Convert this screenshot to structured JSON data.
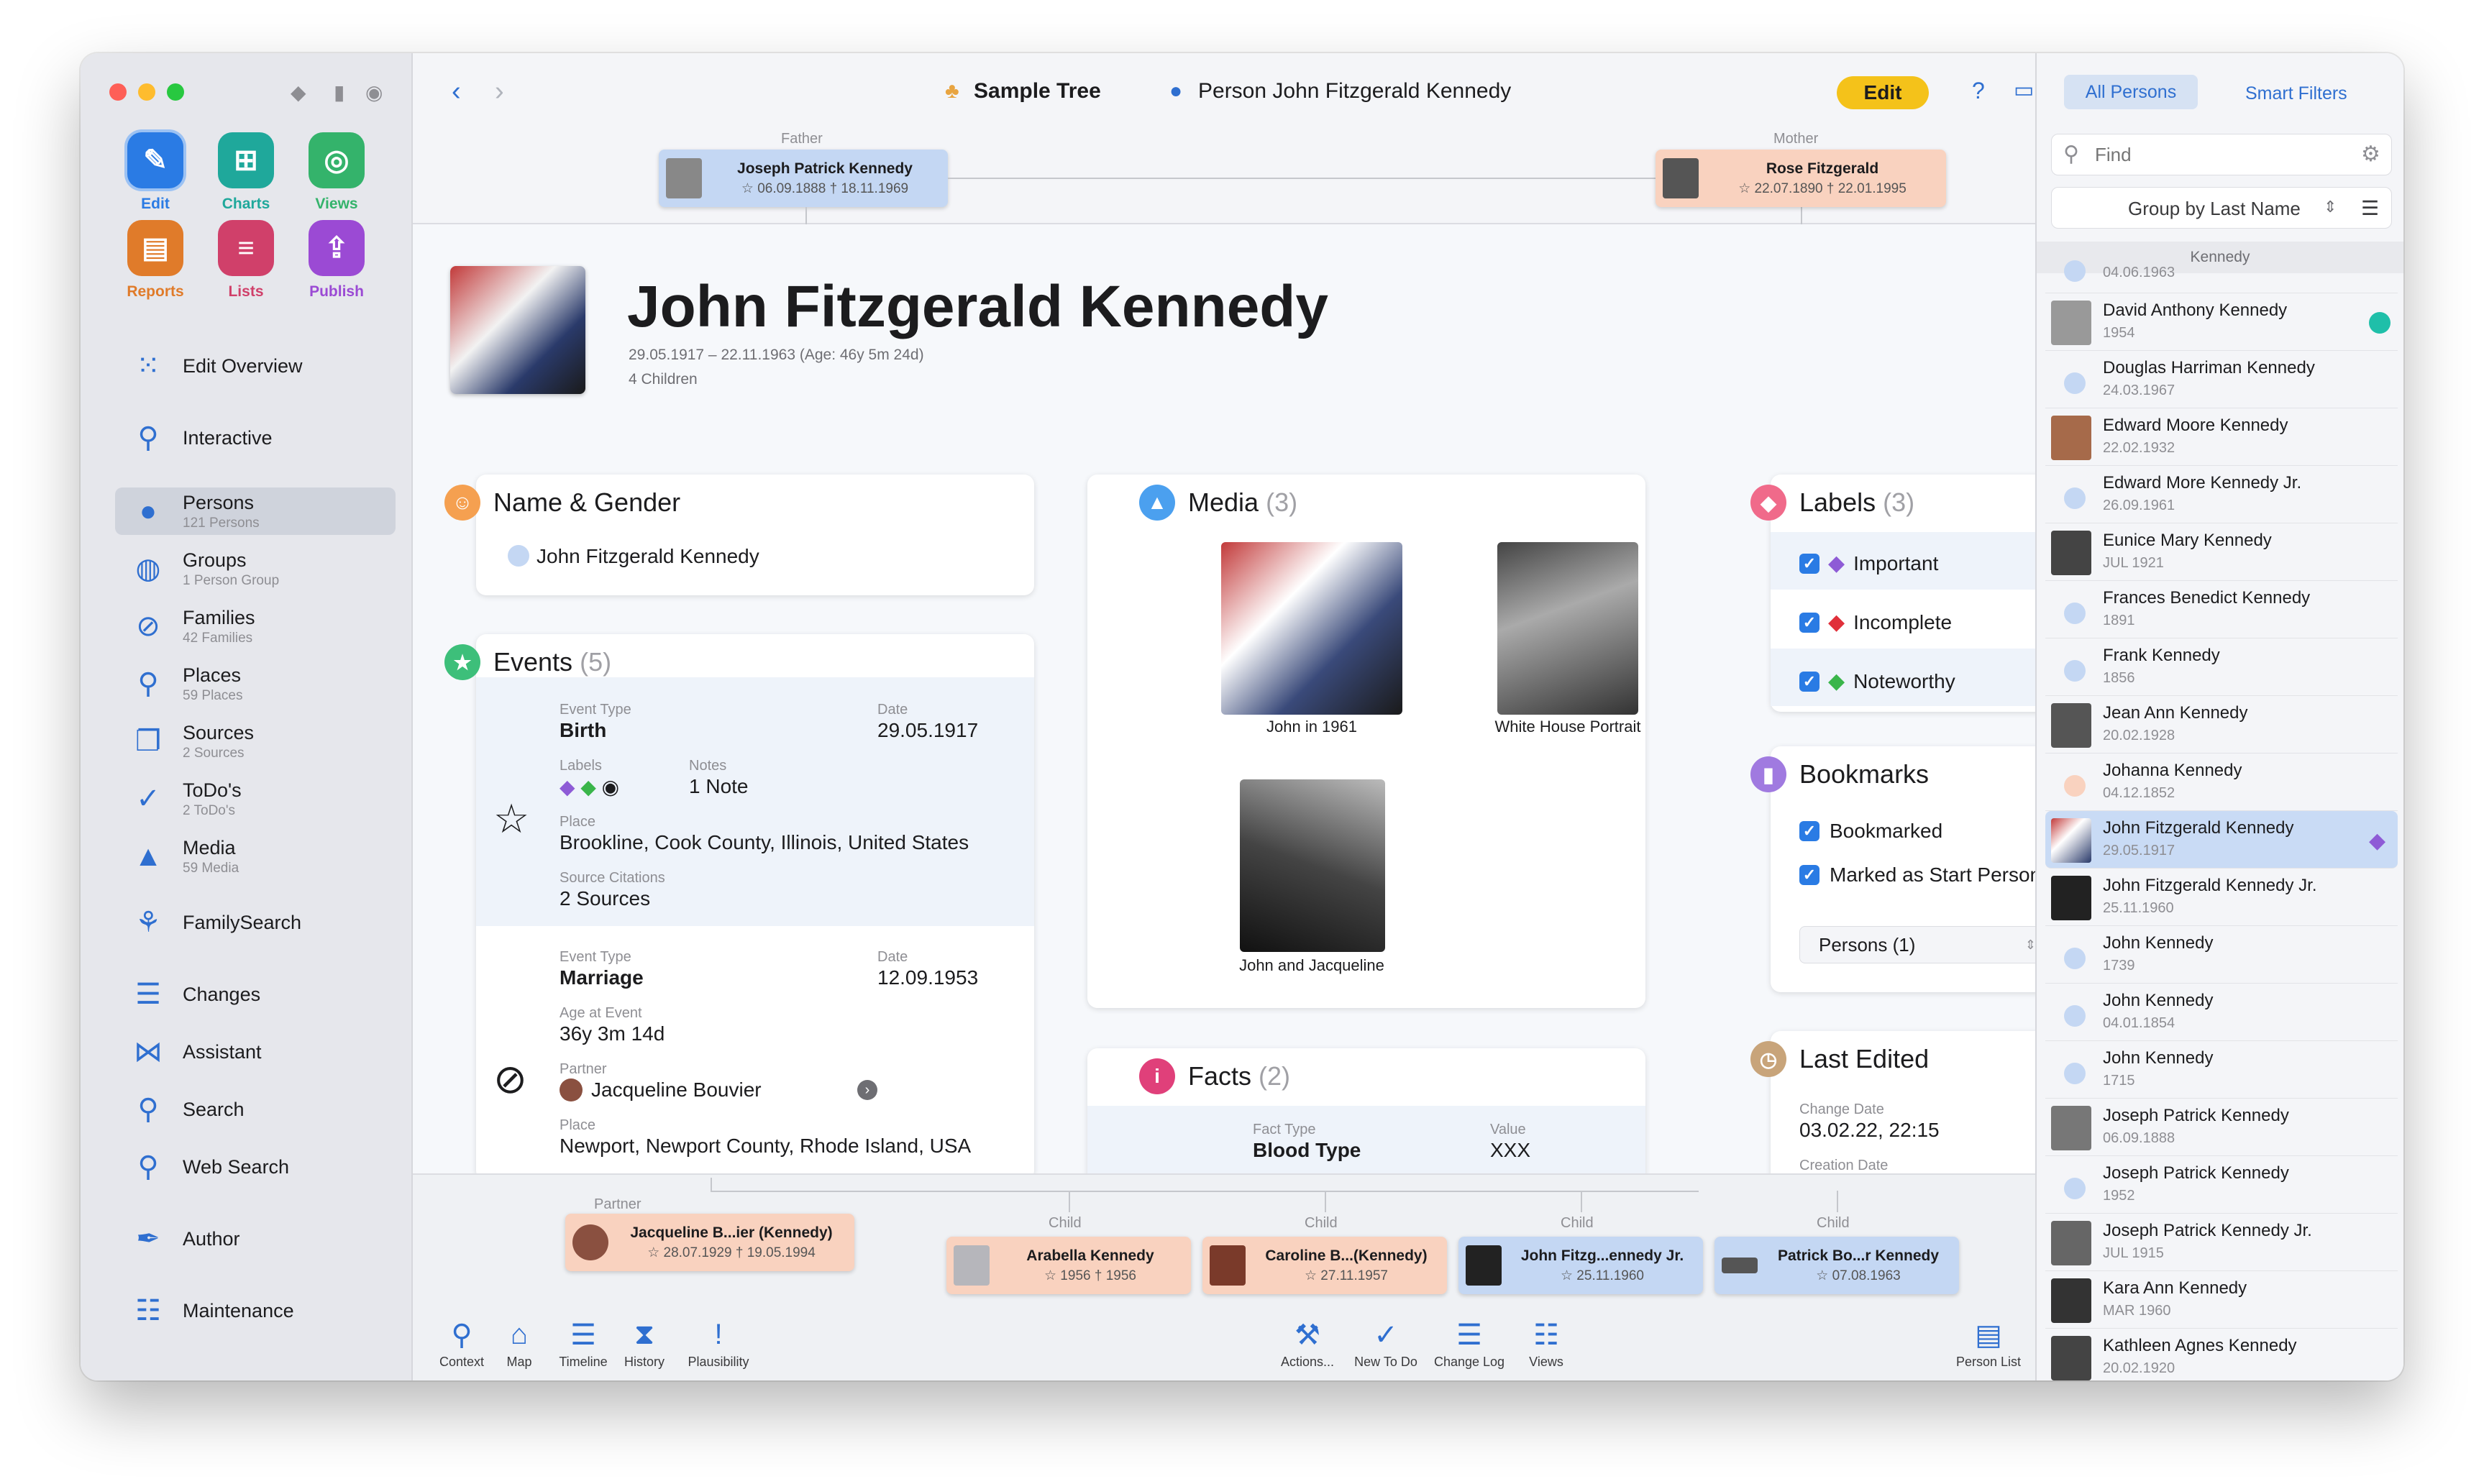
{
  "window": {
    "tree_name": "Sample Tree",
    "breadcrumb": "Person John Fitzgerald Kennedy",
    "edit_label": "Edit"
  },
  "quick_actions": [
    {
      "label": "Edit",
      "icon": "pencil-icon",
      "color": "#2a7be4"
    },
    {
      "label": "Charts",
      "icon": "charts-icon",
      "color": "#1fa89b"
    },
    {
      "label": "Views",
      "icon": "eye-icon",
      "color": "#34b36b"
    },
    {
      "label": "Reports",
      "icon": "reports-icon",
      "color": "#e07b2a"
    },
    {
      "label": "Lists",
      "icon": "lists-icon",
      "color": "#d0406a"
    },
    {
      "label": "Publish",
      "icon": "publish-icon",
      "color": "#9b4ad4"
    }
  ],
  "sidebar": {
    "items": [
      {
        "label": "Edit Overview",
        "sub": ""
      },
      {
        "label": "Interactive",
        "sub": ""
      },
      {
        "label": "Persons",
        "sub": "121 Persons"
      },
      {
        "label": "Groups",
        "sub": "1 Person Group"
      },
      {
        "label": "Families",
        "sub": "42 Families"
      },
      {
        "label": "Places",
        "sub": "59 Places"
      },
      {
        "label": "Sources",
        "sub": "2 Sources"
      },
      {
        "label": "ToDo's",
        "sub": "2 ToDo's"
      },
      {
        "label": "Media",
        "sub": "59 Media"
      },
      {
        "label": "FamilySearch",
        "sub": ""
      },
      {
        "label": "Changes",
        "sub": ""
      },
      {
        "label": "Assistant",
        "sub": ""
      },
      {
        "label": "Search",
        "sub": ""
      },
      {
        "label": "Web Search",
        "sub": ""
      },
      {
        "label": "Author",
        "sub": ""
      },
      {
        "label": "Maintenance",
        "sub": ""
      }
    ]
  },
  "parents": {
    "father_label": "Father",
    "father_name": "Joseph Patrick Kennedy",
    "father_dates": "☆ 06.09.1888 † 18.11.1969",
    "mother_label": "Mother",
    "mother_name": "Rose Fitzgerald",
    "mother_dates": "☆ 22.07.1890 † 22.01.1995"
  },
  "person": {
    "name": "John Fitzgerald Kennedy",
    "life": "29.05.1917 – 22.11.1963 (Age: 46y 5m 24d)",
    "children": "4 Children"
  },
  "name_gender": {
    "title": "Name & Gender",
    "value": "John Fitzgerald Kennedy"
  },
  "events": {
    "title": "Events",
    "count": "(5)",
    "birth": {
      "type_label": "Event Type",
      "type": "Birth",
      "date_label": "Date",
      "date": "29.05.1917",
      "labels_label": "Labels",
      "notes_label": "Notes",
      "notes": "1 Note",
      "place_label": "Place",
      "place": "Brookline, Cook County, Illinois, United States",
      "sources_label": "Source Citations",
      "sources": "2 Sources"
    },
    "marriage": {
      "type_label": "Event Type",
      "type": "Marriage",
      "date_label": "Date",
      "date": "12.09.1953",
      "age_label": "Age at Event",
      "age": "36y 3m 14d",
      "partner_label": "Partner",
      "partner": "Jacqueline Bouvier",
      "place_label": "Place",
      "place": "Newport, Newport County, Rhode Island, USA"
    }
  },
  "media": {
    "title": "Media",
    "count": "(3)",
    "items": [
      "John in 1961",
      "White House Portrait",
      "John and Jacqueline"
    ]
  },
  "facts": {
    "title": "Facts",
    "count": "(2)",
    "type_label": "Fact Type",
    "type": "Blood Type",
    "value_label": "Value",
    "value": "XXX"
  },
  "labels": {
    "title": "Labels",
    "count": "(3)",
    "items": [
      {
        "label": "Important",
        "color": "#8e5bd6"
      },
      {
        "label": "Incomplete",
        "color": "#e0303a"
      },
      {
        "label": "Noteworthy",
        "color": "#3ab54a"
      }
    ]
  },
  "bookmarks": {
    "title": "Bookmarks",
    "bookmarked": "Bookmarked",
    "start_person": "Marked as Start Person",
    "persons_select": "Persons (1)"
  },
  "last_edited": {
    "title": "Last Edited",
    "change_label": "Change Date",
    "change_value": "03.02.22, 22:15",
    "creation_label": "Creation Date"
  },
  "family_bar": {
    "partner_label": "Partner",
    "partner_name": "Jacqueline B...ier (Kennedy)",
    "partner_dates": "☆ 28.07.1929 † 19.05.1994",
    "children": [
      {
        "label": "Child",
        "name": "Arabella Kennedy",
        "dates": "☆ 1956 † 1956"
      },
      {
        "label": "Child",
        "name": "Caroline B...(Kennedy)",
        "dates": "☆ 27.11.1957"
      },
      {
        "label": "Child",
        "name": "John Fitzg...ennedy Jr.",
        "dates": "☆ 25.11.1960"
      },
      {
        "label": "Child",
        "name": "Patrick Bo...r Kennedy",
        "dates": "☆ 07.08.1963"
      }
    ]
  },
  "bottom_tools": {
    "left": [
      "Context",
      "Map",
      "Timeline",
      "History",
      "Plausibility"
    ],
    "right": [
      "Actions...",
      "New To Do",
      "Change Log",
      "Views"
    ],
    "person_list": "Person List"
  },
  "right_panel": {
    "tab_all": "All Persons",
    "tab_smart": "Smart Filters",
    "find_placeholder": "Find",
    "group_by": "Group by Last Name",
    "group_header": "Kennedy",
    "persons": [
      {
        "name": "",
        "date": "04.06.1963"
      },
      {
        "name": "David Anthony Kennedy",
        "date": "1954"
      },
      {
        "name": "Douglas Harriman Kennedy",
        "date": "24.03.1967"
      },
      {
        "name": "Edward Moore Kennedy",
        "date": "22.02.1932"
      },
      {
        "name": "Edward More Kennedy Jr.",
        "date": "26.09.1961"
      },
      {
        "name": "Eunice Mary Kennedy",
        "date": "JUL 1921"
      },
      {
        "name": "Frances Benedict Kennedy",
        "date": "1891"
      },
      {
        "name": "Frank Kennedy",
        "date": "1856"
      },
      {
        "name": "Jean Ann Kennedy",
        "date": "20.02.1928"
      },
      {
        "name": "Johanna Kennedy",
        "date": "04.12.1852"
      },
      {
        "name": "John Fitzgerald Kennedy",
        "date": "29.05.1917"
      },
      {
        "name": "John Fitzgerald Kennedy Jr.",
        "date": "25.11.1960"
      },
      {
        "name": "John Kennedy",
        "date": "1739"
      },
      {
        "name": "John Kennedy",
        "date": "04.01.1854"
      },
      {
        "name": "John Kennedy",
        "date": "1715"
      },
      {
        "name": "Joseph Patrick Kennedy",
        "date": "06.09.1888"
      },
      {
        "name": "Joseph Patrick Kennedy",
        "date": "1952"
      },
      {
        "name": "Joseph Patrick Kennedy Jr.",
        "date": "JUL 1915"
      },
      {
        "name": "Kara Ann Kennedy",
        "date": "MAR 1960"
      },
      {
        "name": "Kathleen Agnes Kennedy",
        "date": "20.02.1920"
      }
    ]
  }
}
